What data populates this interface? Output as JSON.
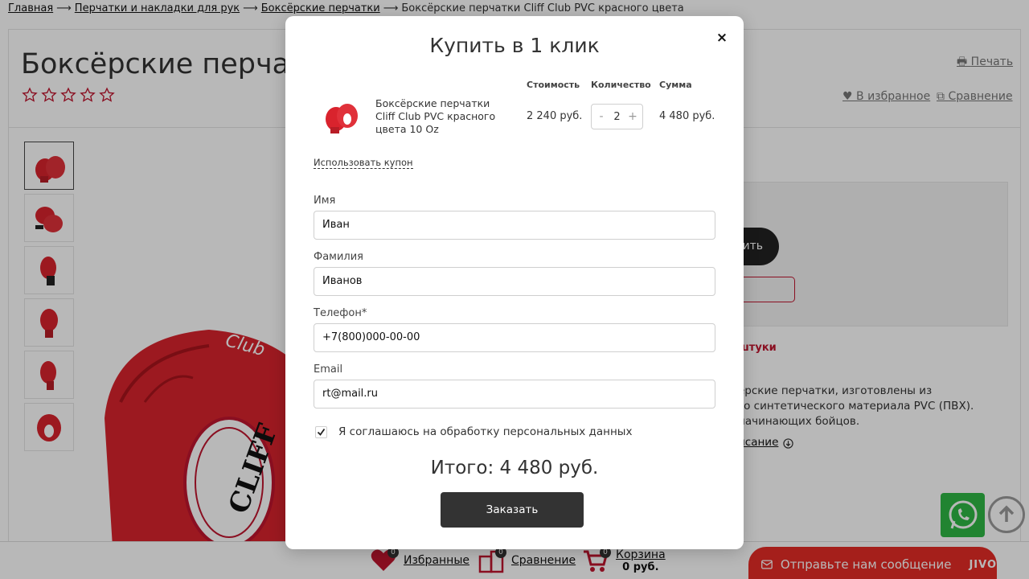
{
  "breadcrumb": {
    "items": [
      "Главная",
      "Перчатки и накладки для рук",
      "Боксёрские перчатки"
    ],
    "current": "Боксёрские перчатки Cliff Club PVC красного цвета",
    "separator": "⟶"
  },
  "product": {
    "title": "Боксёрские перчатки",
    "rating_stars": 5,
    "rating_value": 0,
    "print_label": "Печать",
    "favorites_label": "В избранное",
    "compare_label": "Сравнение",
    "buy_label": "ить",
    "stock_label": "штуки",
    "description_lines": [
      "ёрские перчатки, изготовлены из",
      "го синтетического материала PVC (ПВХ).",
      "начинающих бойцов."
    ],
    "description_link": "исание"
  },
  "bottom_bar": {
    "favorites": {
      "label": "Избранные",
      "count": "0"
    },
    "compare": {
      "label": "Сравнение",
      "count": "0"
    },
    "cart": {
      "label": "Корзина",
      "count": "0",
      "sum": "0 руб."
    }
  },
  "chat": {
    "text": "Отправьте нам сообщение",
    "logo": "JIVO"
  },
  "modal": {
    "title": "Купить в 1 клик",
    "close_symbol": "×",
    "columns": {
      "price": "Стоимость",
      "quantity": "Количество",
      "sum": "Сумма"
    },
    "item": {
      "name": "Боксёрские перчатки Cliff Club PVC красного цвета 10 Oz",
      "price": "2 240 руб.",
      "quantity": "2",
      "sum": "4 480 руб.",
      "minus": "-",
      "plus": "+"
    },
    "coupon_label": "Использовать купон",
    "fields": {
      "first_name": {
        "label": "Имя",
        "value": "Иван"
      },
      "last_name": {
        "label": "Фамилия",
        "value": "Иванов"
      },
      "phone": {
        "label": "Телефон*",
        "value": "+7(800)000-00-00"
      },
      "email": {
        "label": "Email",
        "value": "rt@mail.ru"
      }
    },
    "consent_label": "Я соглашаюсь на обработку персональных данных",
    "consent_checked": true,
    "total_label": "Итого: 4 480 руб.",
    "order_button": "Заказать"
  },
  "colors": {
    "accent_red": "#c0152f",
    "dark_button": "#333333",
    "whatsapp_green": "#2fb844",
    "jivo_red": "#e52b26"
  }
}
